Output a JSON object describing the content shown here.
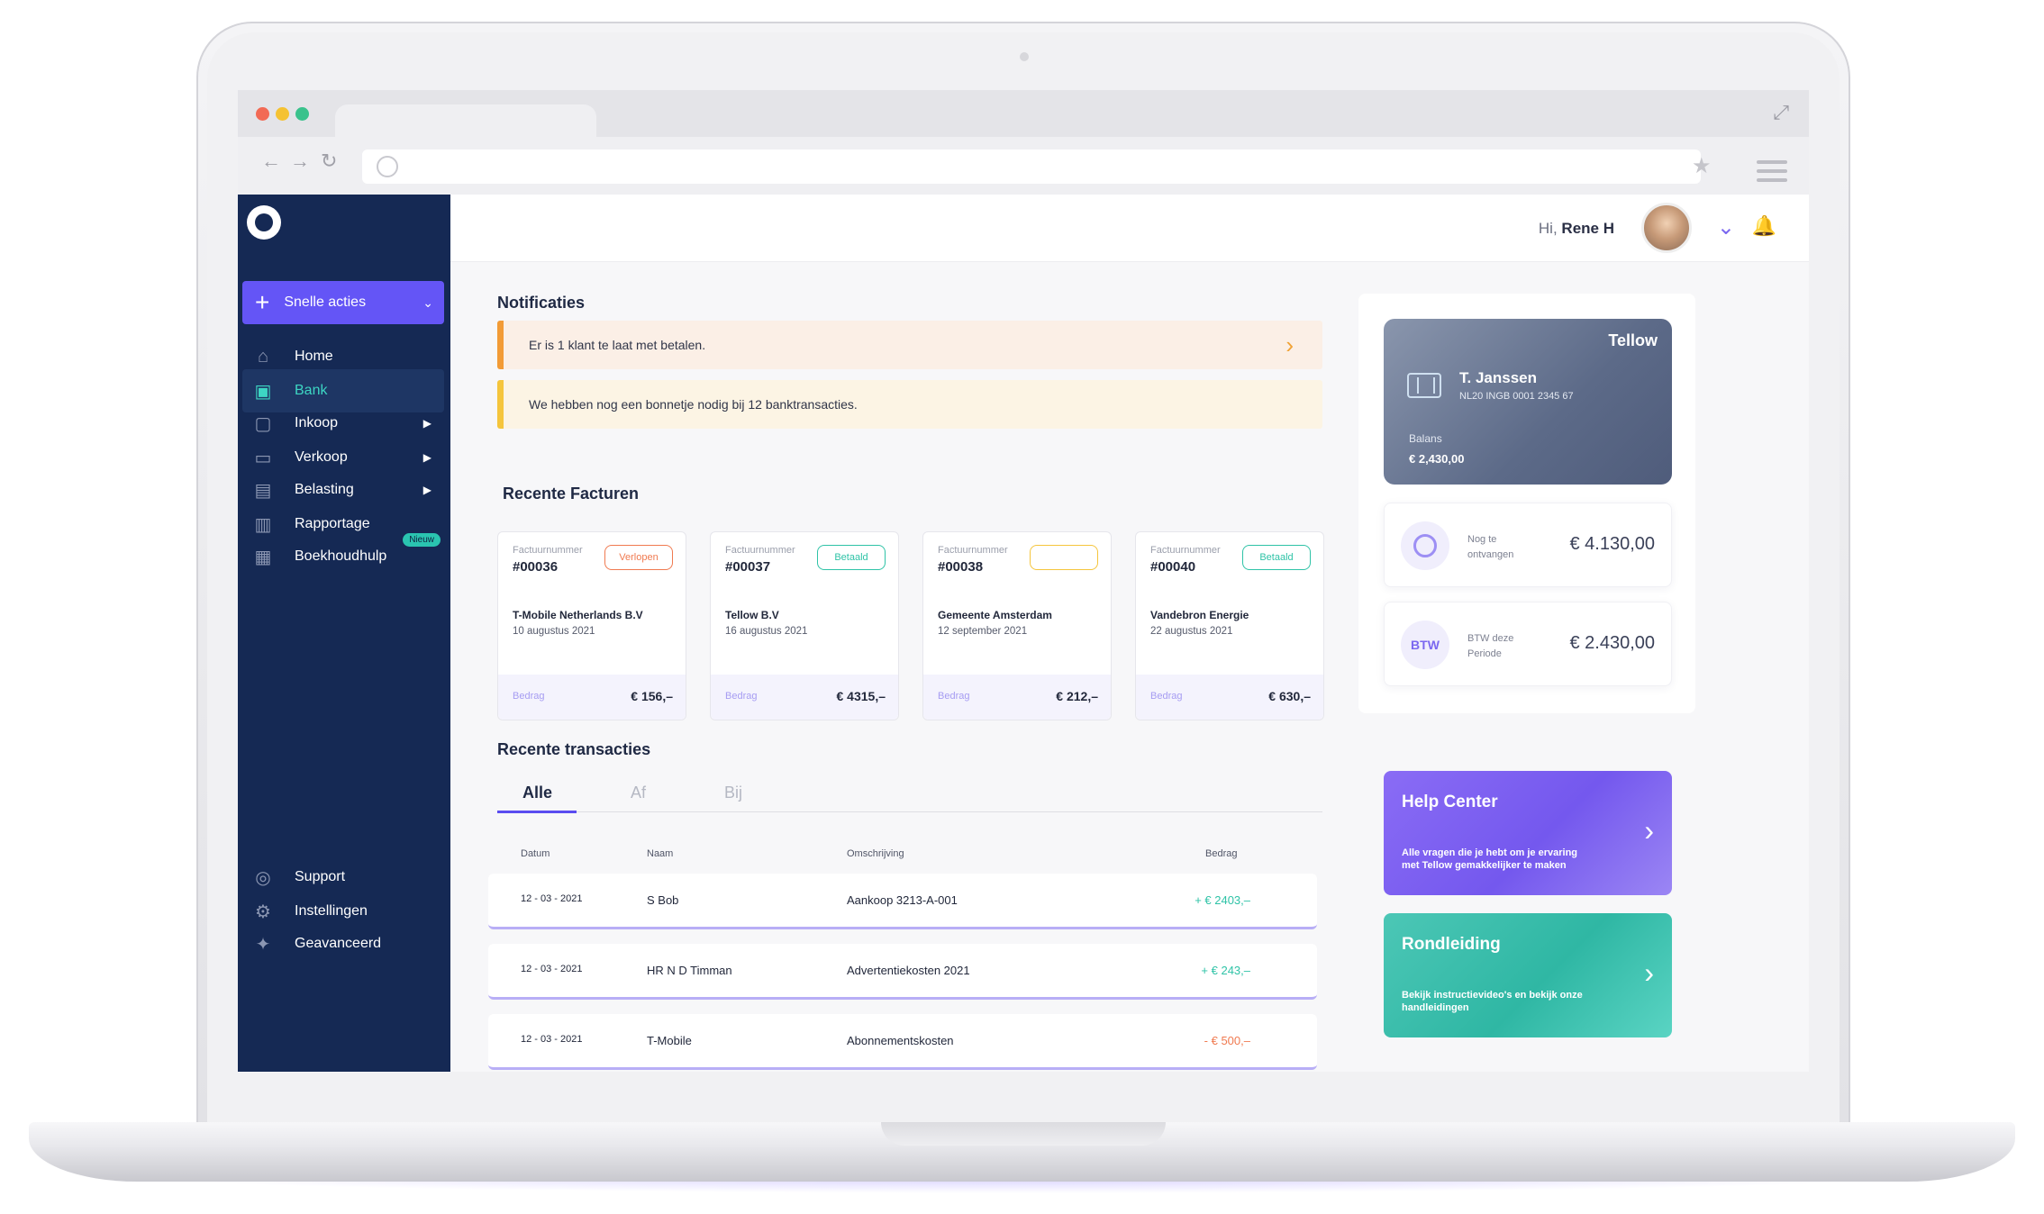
{
  "app": {
    "user_greeting_prefix": "Hi,",
    "user_name": "Rene H"
  },
  "sidebar": {
    "quick_actions": "Snelle acties",
    "items": [
      {
        "label": "Home",
        "icon": "home-icon"
      },
      {
        "label": "Bank",
        "icon": "bank-icon"
      },
      {
        "label": "Inkoop",
        "icon": "inbox-icon"
      },
      {
        "label": "Verkoop",
        "icon": "folder-icon"
      },
      {
        "label": "Belasting",
        "icon": "calculator-icon"
      },
      {
        "label": "Rapportage",
        "icon": "chart-icon"
      },
      {
        "label": "Boekhoudhulp",
        "icon": "briefcase-icon",
        "badge": "Nieuw"
      }
    ],
    "bottom_items": [
      {
        "label": "Support",
        "icon": "support-icon"
      },
      {
        "label": "Instellingen",
        "icon": "settings-icon"
      },
      {
        "label": "Geavanceerd",
        "icon": "puzzle-icon"
      }
    ]
  },
  "notifications": {
    "title": "Notificaties",
    "items": [
      "Er is 1 klant te laat met betalen.",
      "We hebben nog een bonnetje nodig bij 12 banktransacties."
    ]
  },
  "invoices": {
    "title": "Recente Facturen",
    "number_label": "Factuurnummer",
    "amount_label": "Bedrag",
    "items": [
      {
        "number": "#00036",
        "status": "Verlopen",
        "client": "T-Mobile Netherlands B.V",
        "date": "10 augustus 2021",
        "amount": "€ 156,–"
      },
      {
        "number": "#00037",
        "status": "Betaald",
        "client": "Tellow B.V",
        "date": "16 augustus 2021",
        "amount": "€ 4315,–"
      },
      {
        "number": "#00038",
        "status": "",
        "client": "Gemeente Amsterdam",
        "date": "12 september 2021",
        "amount": "€ 212,–"
      },
      {
        "number": "#00040",
        "status": "Betaald",
        "client": "Vandebron Energie",
        "date": "22 augustus 2021",
        "amount": "€ 630,–"
      }
    ]
  },
  "transactions": {
    "title": "Recente transacties",
    "tabs": [
      "Alle",
      "Af",
      "Bij"
    ],
    "columns": [
      "Datum",
      "Naam",
      "Omschrijving",
      "Bedrag"
    ],
    "rows": [
      {
        "date": "12 - 03 - 2021",
        "name": "S Bob",
        "description": "Aankoop 3213-A-001",
        "amount": "+ € 2403,–"
      },
      {
        "date": "12 - 03 - 2021",
        "name": "HR N D Timman",
        "description": "Advertentiekosten 2021",
        "amount": "+ € 243,–"
      },
      {
        "date": "12 - 03 - 2021",
        "name": "T-Mobile",
        "description": "Abonnementskosten",
        "amount": "- € 500,–"
      }
    ]
  },
  "bank_card": {
    "brand": "Tellow",
    "holder": "T. Janssen",
    "iban": "NL20 INGB 0001 2345 67",
    "balance_label": "Balans",
    "balance": "€ 2,430,00"
  },
  "stats": [
    {
      "label": "Nog te ontvangen",
      "value": "€ 4.130,00",
      "icon": "euro-cycle-icon"
    },
    {
      "label": "BTW deze Periode",
      "value": "€ 2.430,00",
      "icon_text": "BTW"
    }
  ],
  "promos": [
    {
      "title": "Help Center",
      "text": "Alle vragen die je hebt om je ervaring met Tellow gemakkelijker te maken",
      "color": "#7b5cf0"
    },
    {
      "title": "Rondleiding",
      "text": "Bekijk instructievideo's en bekijk onze handleidingen",
      "color": "#2fc3a7"
    }
  ],
  "colors": {
    "sidebar": "#152954",
    "accent": "#6455f6",
    "teal": "#3dd6c3",
    "negative": "#f07a50"
  }
}
